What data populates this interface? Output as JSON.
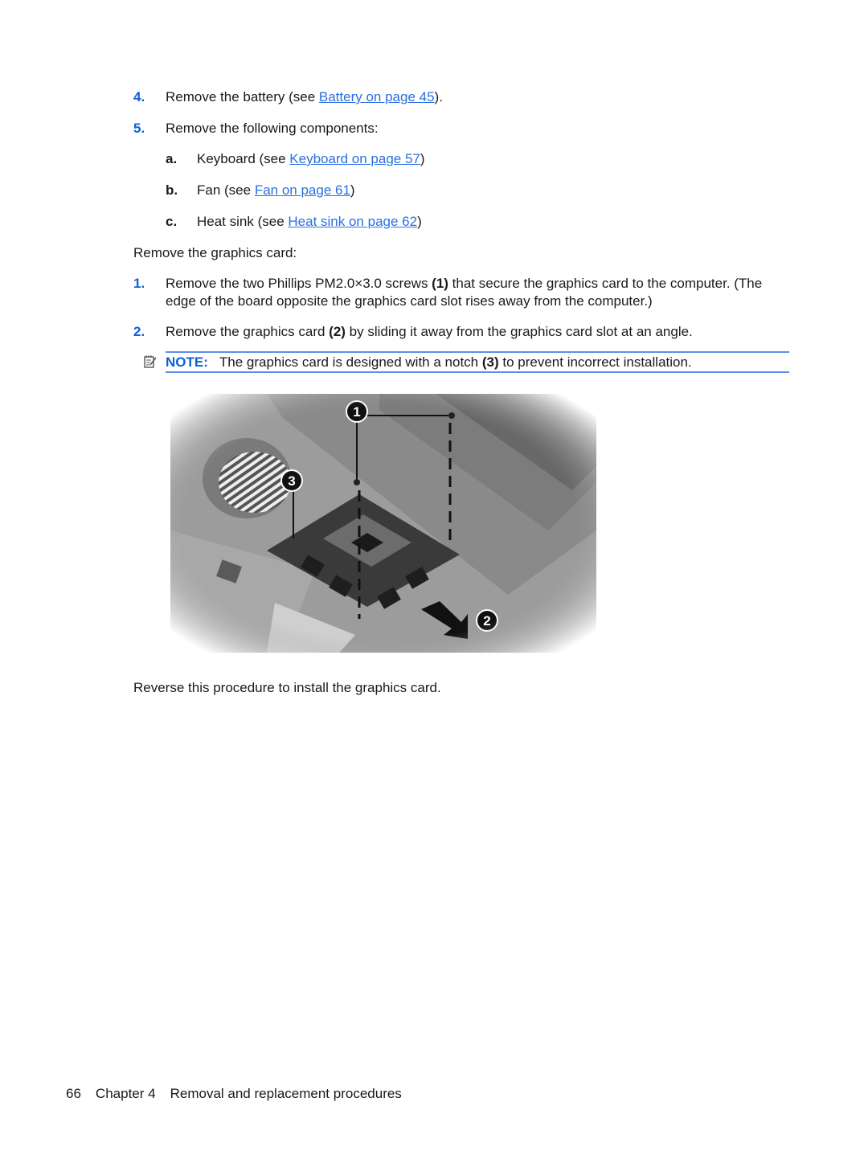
{
  "steps_prereq": [
    {
      "number": "4.",
      "text_before": "Remove the battery (see ",
      "link": "Battery on page 45",
      "text_after": ")."
    },
    {
      "number": "5.",
      "text": "Remove the following components:",
      "substeps": [
        {
          "letter": "a.",
          "text_before": "Keyboard (see ",
          "link": "Keyboard on page 57",
          "text_after": ")"
        },
        {
          "letter": "b.",
          "text_before": "Fan (see ",
          "link": "Fan on page 61",
          "text_after": ")"
        },
        {
          "letter": "c.",
          "text_before": "Heat sink (see ",
          "link": "Heat sink on page 62",
          "text_after": ")"
        }
      ]
    }
  ],
  "intro": "Remove the graphics card:",
  "steps": [
    {
      "number": "1.",
      "line1_before": "Remove the two Phillips PM2.0×3.0 screws ",
      "line1_ref": "(1)",
      "line1_after": " that secure the graphics card to the computer. (The",
      "line2": "edge of the board opposite the graphics card slot rises away from the computer.)"
    },
    {
      "number": "2.",
      "text_before": "Remove the graphics card ",
      "ref": "(2)",
      "text_after": " by sliding it away from the graphics card slot at an angle."
    }
  ],
  "note": {
    "icon": "note-pad-icon",
    "label": "NOTE:",
    "text_before": "The graphics card is designed with a notch ",
    "ref": "(3)",
    "text_after": " to prevent incorrect installation."
  },
  "figure": {
    "description": "Graphics card removal illustration",
    "callouts": [
      "1",
      "2",
      "3"
    ]
  },
  "closing": "Reverse this procedure to install the graphics card.",
  "footer": {
    "page_number": "66",
    "chapter": "Chapter 4",
    "chapter_title": "Removal and replacement procedures"
  },
  "colors": {
    "accent": "#0e5fd8",
    "link": "#2a6fe0",
    "note_rule": "#5b8fe8"
  }
}
